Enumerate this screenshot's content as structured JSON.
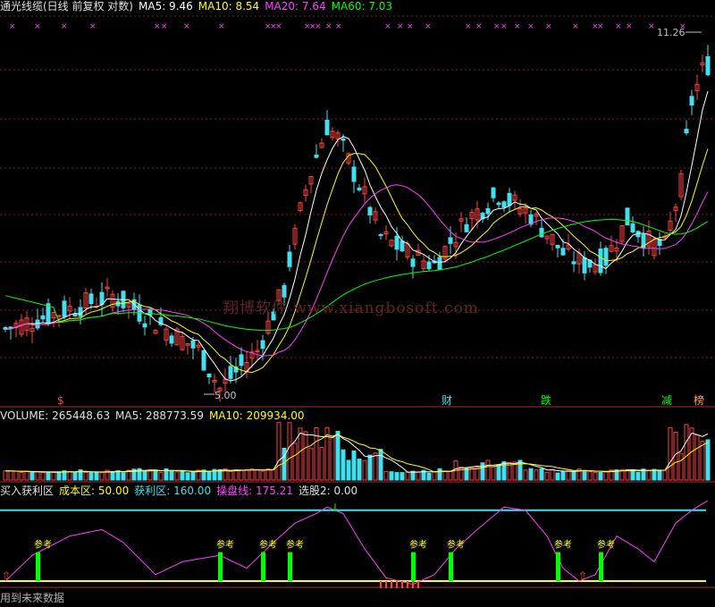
{
  "colors": {
    "up": "#ff4040",
    "down": "#40e0f0",
    "ma5": "#ffffff",
    "ma10": "#ffff00",
    "ma20": "#ff40ff",
    "ma60": "#00ff00",
    "grid": "#802020",
    "magenta": "#ff40ff",
    "green": "#00ff00",
    "yellow": "#ffff00",
    "cyan": "#40e0f0"
  },
  "main": {
    "title": "通光线缆(日线 前复权 对数)",
    "ma5_label": "MA5: 9.46",
    "ma10_label": "MA10: 8.54",
    "ma20_label": "MA20: 7.64",
    "ma60_label": "MA60: 7.03",
    "high_label": "11.26",
    "low_label": "5.00",
    "watermark": "翔博软件  www.xiangbosoft.com",
    "event_labels": [
      "$",
      "财",
      "跌",
      "减",
      "榜"
    ]
  },
  "volume": {
    "vol_label": "VOLUME: 265448.63",
    "ma5_label": "MA5: 288773.59",
    "ma10_label": "MA10: 209934.00"
  },
  "indicator": {
    "name": "买入获利区",
    "cost_label": "成本区: 50.00",
    "profit_label": "获利区: 160.00",
    "trade_label": "操盘线: 175.21",
    "select_label": "选股2: 0.00",
    "ref_label": "参考",
    "footer": "用到未来数据"
  }
}
